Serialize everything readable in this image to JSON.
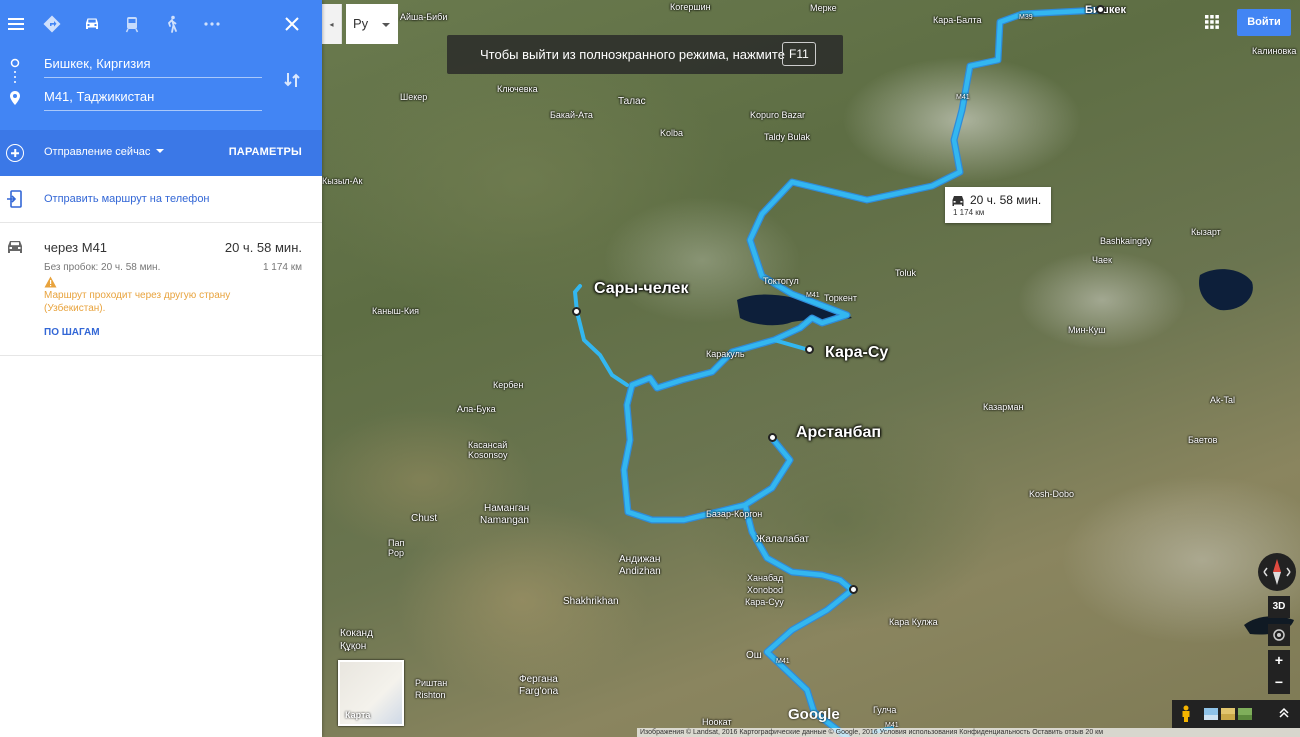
{
  "panel": {
    "modes": [
      "menu-icon",
      "directions-icon",
      "car-icon",
      "transit-icon",
      "walk-icon",
      "more-icon",
      "close-icon"
    ],
    "origin": "Бишкек, Киргизия",
    "destination": "М41, Таджикистан",
    "depart_label": "Отправление сейчас",
    "params_label": "ПАРАМЕТРЫ",
    "send_label": "Отправить маршрут на телефон",
    "route": {
      "via": "через М41",
      "duration": "20 ч. 58 мин.",
      "no_traffic": "Без пробок: 20 ч. 58 мин.",
      "distance": "1 174 км",
      "warning": "Маршрут проходит через другую страну (Узбекистан).",
      "steps_label": "ПО ШАГАМ"
    }
  },
  "map": {
    "lang_selected": "Ру",
    "lang_prev": "◂",
    "fullscreen_text": "Чтобы выйти из полноэкранного режима, нажмите",
    "fullscreen_key": "F11",
    "signin_label": "Войти",
    "tooltip": {
      "time": "20 ч. 58 мин.",
      "distance": "1 174 км"
    },
    "big_labels": {
      "sary_chelek": "Сары-челек",
      "kara_su": "Кара-Су",
      "arstanbap": "Арстанбап"
    },
    "labels": {
      "bishkek": "Бишкек",
      "kara_balta": "Кара-Балта",
      "merke": "Мерке",
      "aisha_bibi": "Айша-Биби",
      "kogershin": "Когершин",
      "m39": "M39",
      "m41_a": "M41",
      "m41_b": "M41",
      "m41_c": "M41",
      "m41_d": "M41",
      "kalinovka": "Калиновка",
      "sheker": "Шекер",
      "klyuchevka": "Ключевка",
      "talas": "Талас",
      "bakai_ata": "Бакай-Ата",
      "kopuro_bazar": "Kopuro Bazar",
      "kolba": "Kolba",
      "taldy_bulak": "Taldy Bulak",
      "kysyl_ak": "Кызыл-Ак",
      "bashkaingdy": "Bashkaingdy",
      "kyzart": "Кызарт",
      "chaek": "Чаек",
      "toktogul": "Токтогул",
      "torkent": "Торкент",
      "toluk": "Toluk",
      "kanysh_kiya": "Каныш-Кия",
      "karakul": "Каракуль",
      "min_kush": "Мин-Куш",
      "kerben": "Кербен",
      "ala_buka": "Ала-Бука",
      "kasansai": "Касансай",
      "kosonsoy": "Kosonsoy",
      "kazarman": "Казарман",
      "ak_tal": "Ak-Tal",
      "baetov": "Баетов",
      "kosh_dobo": "Kosh-Dobo",
      "chust": "Chust",
      "namangan_ru": "Наманган",
      "namangan_lat": "Namangan",
      "bazar_korgon": "Базар-Коргон",
      "jalal_abad": "Жалалабат",
      "pap_ru": "Пап",
      "pop": "Pop",
      "andijan_ru": "Андижан",
      "andijan_lat": "Andizhan",
      "khanabad_ru": "Ханабад",
      "xonobod": "Xonobod",
      "kara_suu": "Кара-Суу",
      "kara_kulzha": "Кара Кулжа",
      "shakhrikhan": "Shakhrikhan",
      "kokand_ru": "Коканд",
      "kokand_lat": "Құқон",
      "osh": "Ош",
      "rishtan_ru": "Риштан",
      "rishton": "Rishton",
      "fergana_ru": "Фергана",
      "fargona": "Farg'ona",
      "nookat": "Ноокат",
      "gulcha": "Гулча"
    },
    "minimap_label": "Карта",
    "google_logo": "Google",
    "ctl_3d": "3D",
    "zoom_in": "+",
    "zoom_out": "−",
    "footer": "Изображения © Landsat, 2016 Картографические данные © Google, 2016   Условия использования   Конфиденциальность   Оставить отзыв   20 км"
  },
  "colors": {
    "brand_blue": "#4285f4",
    "route_blue": "#33b7f0",
    "link_blue": "#3367d6",
    "warning_orange": "#e8a33d"
  }
}
